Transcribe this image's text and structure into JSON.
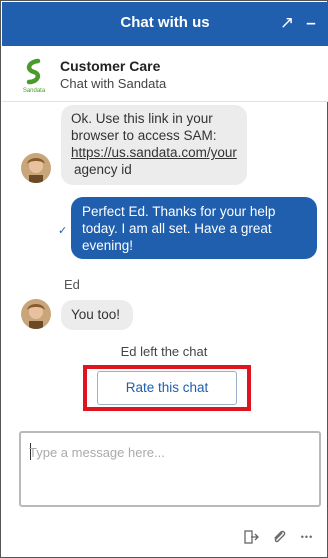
{
  "header": {
    "title": "Chat with us",
    "popout_glyph": "↗",
    "minimize_glyph": "–"
  },
  "agent": {
    "name": "Customer Care",
    "subtitle": "Chat with Sandata",
    "logo_text": "Sandata",
    "logo_color": "#4a9a2e"
  },
  "messages": [
    {
      "from": "agent",
      "lines": [
        "Ok.  Use this link in your",
        "browser to access SAM:"
      ],
      "link": "https://us.sandata.com/your",
      "tail": "agency id"
    },
    {
      "from": "user",
      "lines": [
        "Perfect Ed. Thanks for your help",
        "today. I am all set. Have a great",
        "evening!"
      ],
      "status": "✓"
    },
    {
      "from": "agent",
      "sender": "Ed",
      "text": "You too!"
    }
  ],
  "system": {
    "left_text": "Ed left the chat"
  },
  "rate_button": {
    "label": "Rate this chat"
  },
  "composer": {
    "placeholder": "Type a message here..."
  },
  "toolbar": {
    "icons": [
      "exit-icon",
      "paperclip-icon",
      "more-icon"
    ],
    "more_glyph": "•••"
  },
  "colors": {
    "brand_blue": "#1f5fae",
    "highlight_red": "#e0141e",
    "agent_bubble": "#ececec"
  }
}
